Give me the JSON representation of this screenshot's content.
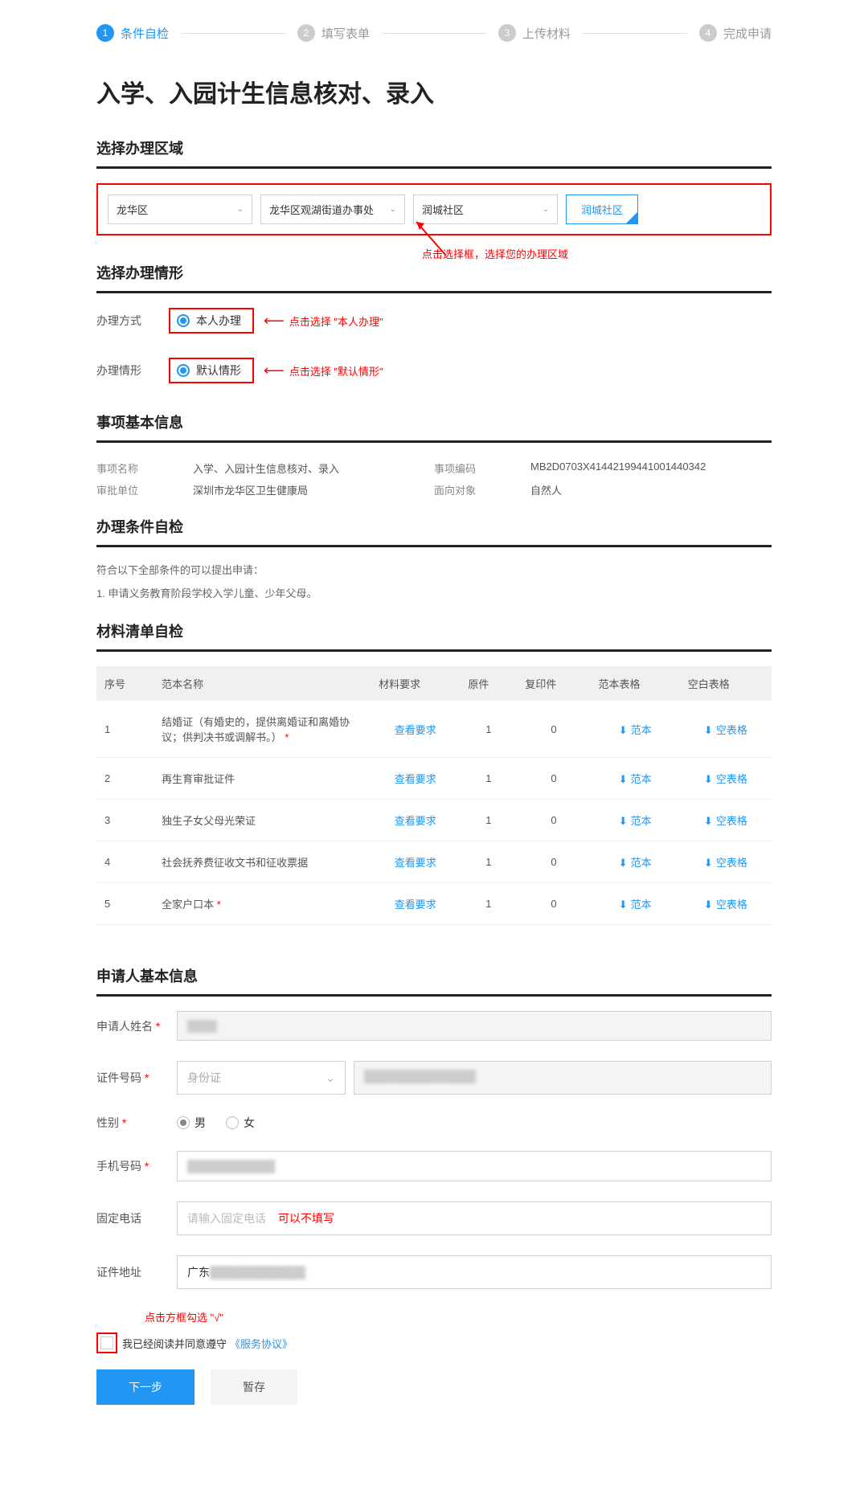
{
  "steps": [
    {
      "num": "1",
      "label": "条件自检",
      "active": true
    },
    {
      "num": "2",
      "label": "填写表单",
      "active": false
    },
    {
      "num": "3",
      "label": "上传材料",
      "active": false
    },
    {
      "num": "4",
      "label": "完成申请",
      "active": false
    }
  ],
  "main_title": "入学、入园计生信息核对、录入",
  "sections": {
    "region": "选择办理区域",
    "situation": "选择办理情形",
    "basic": "事项基本信息",
    "conditions": "办理条件自检",
    "materials": "材料清单自检",
    "applicant": "申请人基本信息"
  },
  "region_selects": [
    "龙华区",
    "龙华区观湖街道办事处",
    "润城社区"
  ],
  "region_confirm": "润城社区",
  "annotations": {
    "region": "点击选择框，选择您的办理区域",
    "method": "点击选择 \"本人办理\"",
    "scenario": "点击选择 \"默认情形\"",
    "checkbox": "点击方框勾选 \"√\""
  },
  "situation": {
    "method_label": "办理方式",
    "method_value": "本人办理",
    "scenario_label": "办理情形",
    "scenario_value": "默认情形"
  },
  "basic_info": {
    "name_label": "事项名称",
    "name_value": "入学、入园计生信息核对、录入",
    "code_label": "事项编码",
    "code_value": "MB2D0703X41442199441001440342",
    "dept_label": "审批单位",
    "dept_value": "深圳市龙华区卫生健康局",
    "target_label": "面向对象",
    "target_value": "自然人"
  },
  "conditions": {
    "intro": "符合以下全部条件的可以提出申请：",
    "item1": "1. 申请义务教育阶段学校入学儿童、少年父母。"
  },
  "materials": {
    "headers": {
      "seq": "序号",
      "name": "范本名称",
      "req": "材料要求",
      "orig": "原件",
      "copy": "复印件",
      "sample": "范本表格",
      "blank": "空白表格"
    },
    "view_req": "查看要求",
    "sample_link": "范本",
    "blank_link": "空表格",
    "rows": [
      {
        "seq": "1",
        "name": "结婚证（有婚史的，提供离婚证和离婚协议；供判决书或调解书。）",
        "required": true,
        "orig": "1",
        "copy": "0"
      },
      {
        "seq": "2",
        "name": "再生育审批证件",
        "orig": "1",
        "copy": "0"
      },
      {
        "seq": "3",
        "name": "独生子女父母光荣证",
        "orig": "1",
        "copy": "0"
      },
      {
        "seq": "4",
        "name": "社会抚养费征收文书和征收票据",
        "orig": "1",
        "copy": "0"
      },
      {
        "seq": "5",
        "name": "全家户口本",
        "required": true,
        "orig": "1",
        "copy": "0"
      }
    ]
  },
  "applicant": {
    "name_label": "申请人姓名",
    "id_label": "证件号码",
    "id_type": "身份证",
    "gender_label": "性别",
    "gender_male": "男",
    "gender_female": "女",
    "phone_label": "手机号码",
    "tel_label": "固定电话",
    "tel_placeholder": "请输入固定电话",
    "tel_hint": "可以不填写",
    "addr_label": "证件地址",
    "addr_value": "广东",
    "agree_text": "我已经阅读并同意遵守",
    "agree_link": "《服务协议》"
  },
  "buttons": {
    "next": "下一步",
    "save": "暂存"
  }
}
